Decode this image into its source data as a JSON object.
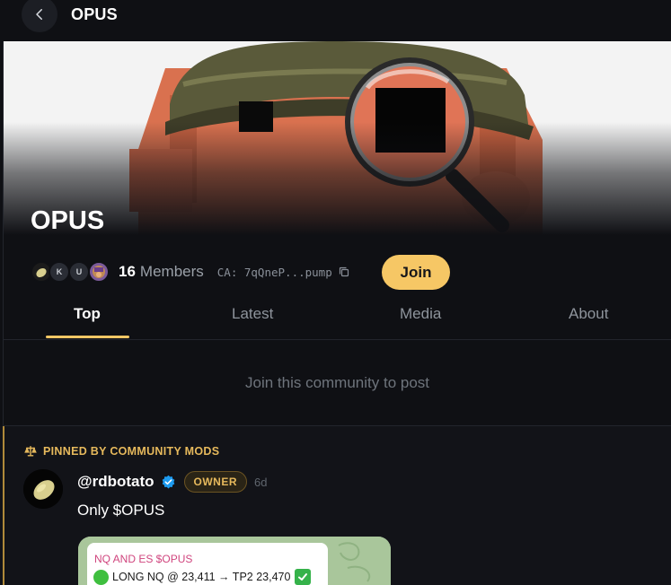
{
  "header": {
    "title": "OPUS"
  },
  "community": {
    "name": "OPUS",
    "member_count": "16",
    "members_label": "Members",
    "avatars": [
      {
        "initial": ""
      },
      {
        "initial": "K"
      },
      {
        "initial": "U"
      },
      {
        "initial": ""
      }
    ],
    "contract_address": "CA: 7qQneP...pump",
    "join_label": "Join"
  },
  "tabs": [
    {
      "label": "Top",
      "active": true
    },
    {
      "label": "Latest",
      "active": false
    },
    {
      "label": "Media",
      "active": false
    },
    {
      "label": "About",
      "active": false
    }
  ],
  "join_prompt": "Join this community to post",
  "pinned_post": {
    "pinned_label": "PINNED BY COMMUNITY MODS",
    "handle": "@rdbotato",
    "badge": "OWNER",
    "time": "6d",
    "text": "Only $OPUS",
    "media": {
      "title": "NQ AND ES $OPUS",
      "line": "LONG NQ @ 23,411 → TP2 23,470"
    }
  },
  "colors": {
    "accent": "#f6c765",
    "pinned": "#e6b95c",
    "verified": "#1d9bf0",
    "background": "#0f1014"
  }
}
